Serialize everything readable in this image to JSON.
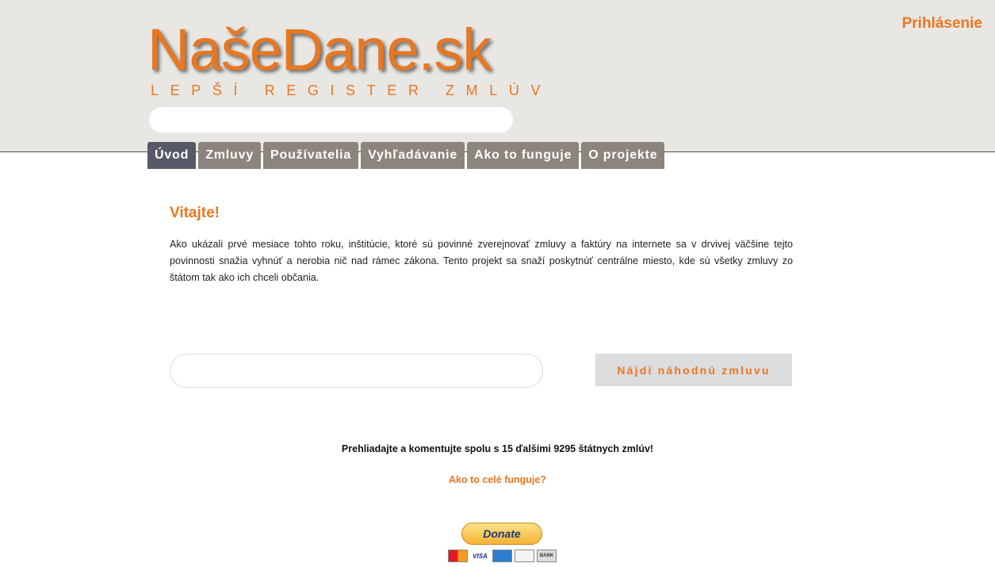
{
  "header": {
    "login_label": "Prihlásenie",
    "logo_main": "NašeDane.sk",
    "logo_sub": "LEPŠÍ REGISTER ZMLÚV",
    "search_placeholder": ""
  },
  "nav": {
    "tabs": [
      {
        "label": "Úvod",
        "active": true
      },
      {
        "label": "Zmluvy",
        "active": false
      },
      {
        "label": "Používatelia",
        "active": false
      },
      {
        "label": "Vyhľadávanie",
        "active": false
      },
      {
        "label": "Ako to funguje",
        "active": false
      },
      {
        "label": "O projekte",
        "active": false
      }
    ]
  },
  "main": {
    "welcome_title": "Vitajte!",
    "intro_text": "Ako ukázali prvé mesiace tohto roku, inštitúcie, ktoré sú povinné zverejnovať zmluvy a faktúry na internete sa v drvivej väčšine tejto povinnosti snažia vyhnúť a nerobia nič nad rámec zákona. Tento projekt sa snaží poskytnúť centrálne miesto, kde sú všetky zmluvy zo štátom tak ako ich chceli občania.",
    "random_input_placeholder": "",
    "random_button_label": "Nájdi náhodnú zmluvu",
    "browse_text": "Prehliadajte a komentujte spolu s 15 ďalšími 9295 štátnych zmlúv!",
    "how_link": "Ako to celé funguje?"
  },
  "donate": {
    "button_label": "Donate",
    "cards": [
      "mastercard-icon",
      "visa-icon",
      "amex-icon",
      "discover-icon",
      "bank-icon"
    ],
    "visa_label": "VISA",
    "bank_label": "BANK"
  },
  "colors": {
    "accent": "#e87722",
    "header_bg": "#e8e7e4",
    "nav_tab": "#8c857d",
    "nav_tab_active": "#575a66"
  }
}
